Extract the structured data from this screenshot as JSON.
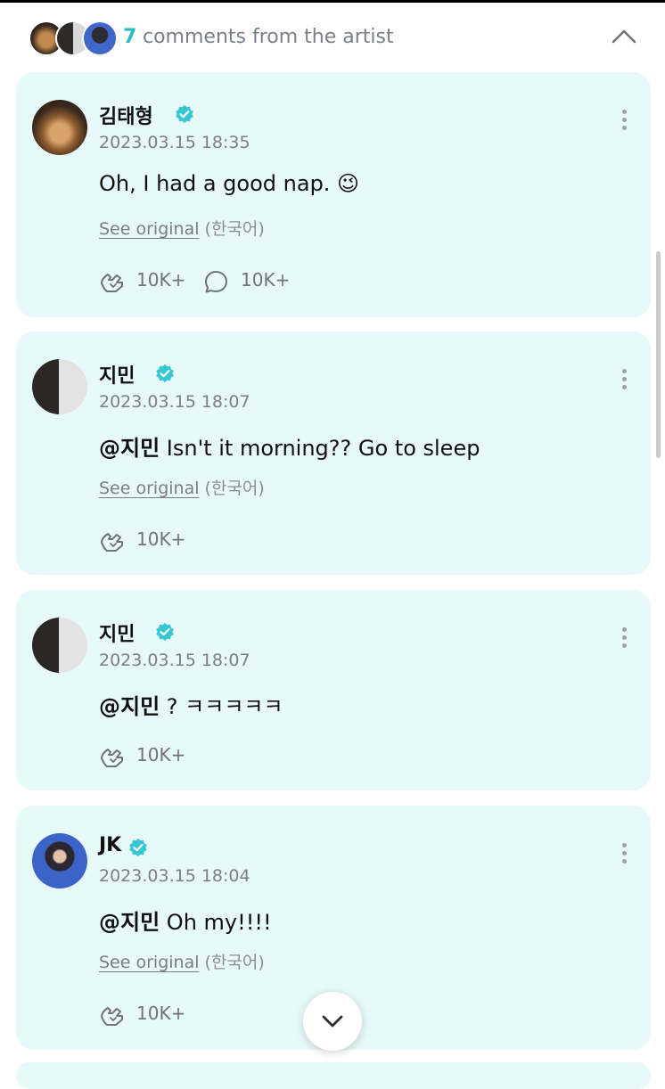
{
  "header": {
    "count": "7",
    "label": "comments from the artist",
    "avatars": [
      "dog-photo-avatar",
      "masked-duo-avatar",
      "blue-portrait-avatar"
    ]
  },
  "comments": [
    {
      "author": "김태형",
      "verified": true,
      "time": "2023.03.15 18:35",
      "mention": "",
      "text": "Oh, I had a good nap. 😉",
      "see_original": "See original",
      "language": "(한국어)",
      "likes": "10K+",
      "replies": "10K+"
    },
    {
      "author": "지민",
      "verified": true,
      "time": "2023.03.15 18:07",
      "mention": "@지민",
      "text": " Isn't it morning?? Go to sleep",
      "see_original": "See original",
      "language": "(한국어)",
      "likes": "10K+"
    },
    {
      "author": "지민",
      "verified": true,
      "time": "2023.03.15 18:07",
      "mention": "@지민",
      "text": " ? ㅋㅋㅋㅋㅋ",
      "likes": "10K+"
    },
    {
      "author": "JK",
      "verified": true,
      "time": "2023.03.15 18:04",
      "mention": "@지민",
      "text": " Oh my!!!!",
      "see_original": "See original",
      "language": "(한국어)",
      "likes": "10K+"
    }
  ],
  "colors": {
    "accent": "#2bbcc6",
    "card_background": "#e7f9f8",
    "verified_badge": "#35c8d2"
  }
}
